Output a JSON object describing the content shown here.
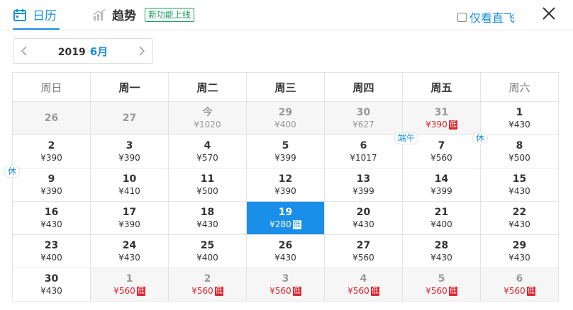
{
  "header": {
    "tab_calendar": "日历",
    "tab_trend": "趋势",
    "new_badge": "新功能上线",
    "direct_only": "仅看直飞"
  },
  "monthnav": {
    "year": "2019",
    "month": "6月"
  },
  "weekdays": [
    "周日",
    "周一",
    "周二",
    "周三",
    "周四",
    "周五",
    "周六"
  ],
  "days": [
    {
      "num": "26",
      "price": "",
      "dim": true
    },
    {
      "num": "27",
      "price": "",
      "dim": true
    },
    {
      "num": "今",
      "price": "¥1020",
      "dim": true
    },
    {
      "num": "29",
      "price": "¥400",
      "dim": true
    },
    {
      "num": "30",
      "price": "¥627",
      "dim": true
    },
    {
      "num": "31",
      "price": "¥390",
      "dim": true,
      "low": true,
      "lowtag": "低"
    },
    {
      "num": "1",
      "price": "¥430"
    },
    {
      "num": "2",
      "price": "¥390"
    },
    {
      "num": "3",
      "price": "¥390"
    },
    {
      "num": "4",
      "price": "¥570"
    },
    {
      "num": "5",
      "price": "¥399"
    },
    {
      "num": "6",
      "price": "¥1017"
    },
    {
      "num": "7",
      "price": "¥560",
      "holiday": "端午"
    },
    {
      "num": "8",
      "price": "¥500",
      "holiday": "休"
    },
    {
      "num": "9",
      "price": "¥390",
      "holiday": "休"
    },
    {
      "num": "10",
      "price": "¥410"
    },
    {
      "num": "11",
      "price": "¥500"
    },
    {
      "num": "12",
      "price": "¥390"
    },
    {
      "num": "13",
      "price": "¥399"
    },
    {
      "num": "14",
      "price": "¥399"
    },
    {
      "num": "15",
      "price": "¥430"
    },
    {
      "num": "16",
      "price": "¥430"
    },
    {
      "num": "17",
      "price": "¥390"
    },
    {
      "num": "18",
      "price": "¥430"
    },
    {
      "num": "19",
      "price": "¥280",
      "selected": true,
      "lowtag": "低"
    },
    {
      "num": "20",
      "price": "¥430"
    },
    {
      "num": "21",
      "price": "¥400"
    },
    {
      "num": "22",
      "price": "¥430"
    },
    {
      "num": "23",
      "price": "¥400"
    },
    {
      "num": "24",
      "price": "¥430"
    },
    {
      "num": "25",
      "price": "¥400"
    },
    {
      "num": "26",
      "price": "¥430"
    },
    {
      "num": "27",
      "price": "¥560"
    },
    {
      "num": "28",
      "price": "¥430"
    },
    {
      "num": "29",
      "price": "¥430"
    },
    {
      "num": "30",
      "price": "¥430"
    },
    {
      "num": "1",
      "price": "¥560",
      "dim": true,
      "low": true,
      "lowtag": "低"
    },
    {
      "num": "2",
      "price": "¥560",
      "dim": true,
      "low": true,
      "lowtag": "低"
    },
    {
      "num": "3",
      "price": "¥560",
      "dim": true,
      "low": true,
      "lowtag": "低"
    },
    {
      "num": "4",
      "price": "¥560",
      "dim": true,
      "low": true,
      "lowtag": "低"
    },
    {
      "num": "5",
      "price": "¥560",
      "dim": true,
      "low": true,
      "lowtag": "低"
    },
    {
      "num": "6",
      "price": "¥560",
      "dim": true,
      "low": true,
      "lowtag": "低"
    }
  ],
  "colors": {
    "accent": "#1a8fdd",
    "selected": "#1a8fe8",
    "low": "#d9232d",
    "badge": "#1a9a5b"
  }
}
